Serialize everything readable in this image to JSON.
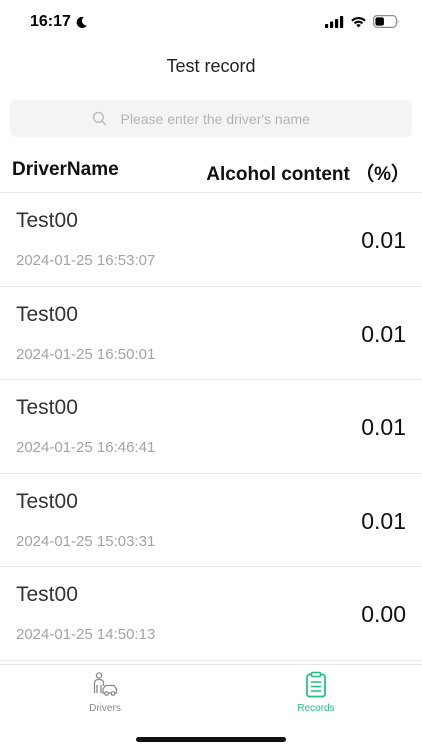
{
  "status_bar": {
    "time": "16:17"
  },
  "nav": {
    "title": "Test record"
  },
  "search": {
    "placeholder": "Please enter the driver's name",
    "value": ""
  },
  "table": {
    "col_driver": "DriverName",
    "col_alcohol": "Alcohol content （%）"
  },
  "records": [
    {
      "name": "Test00",
      "time": "2024-01-25 16:53:07",
      "value": "0.01"
    },
    {
      "name": "Test00",
      "time": "2024-01-25 16:50:01",
      "value": "0.01"
    },
    {
      "name": "Test00",
      "time": "2024-01-25 16:46:41",
      "value": "0.01"
    },
    {
      "name": "Test00",
      "time": "2024-01-25 15:03:31",
      "value": "0.01"
    },
    {
      "name": "Test00",
      "time": "2024-01-25 14:50:13",
      "value": "0.00"
    }
  ],
  "tabs": {
    "drivers": "Drivers",
    "records": "Records"
  },
  "colors": {
    "accent": "#1fbf80",
    "inactive": "#8a8a8e"
  }
}
